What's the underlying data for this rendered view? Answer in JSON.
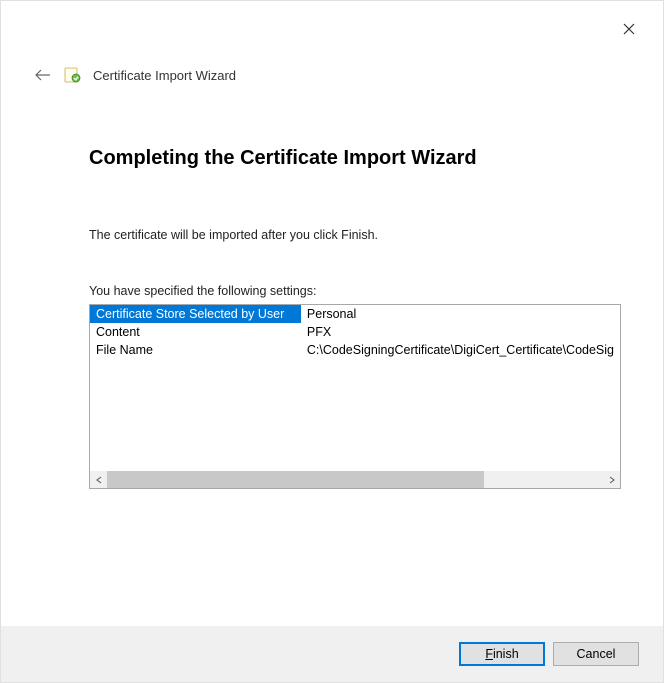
{
  "window": {
    "title": "Certificate Import Wizard"
  },
  "main": {
    "heading": "Completing the Certificate Import Wizard",
    "info": "The certificate will be imported after you click Finish.",
    "settings_label": "You have specified the following settings:",
    "rows": [
      {
        "key": "Certificate Store Selected by User",
        "value": "Personal"
      },
      {
        "key": "Content",
        "value": "PFX"
      },
      {
        "key": "File Name",
        "value": "C:\\CodeSigningCertificate\\DigiCert_Certificate\\CodeSig"
      }
    ]
  },
  "footer": {
    "finish_accel": "F",
    "finish_rest": "inish",
    "cancel": "Cancel"
  }
}
